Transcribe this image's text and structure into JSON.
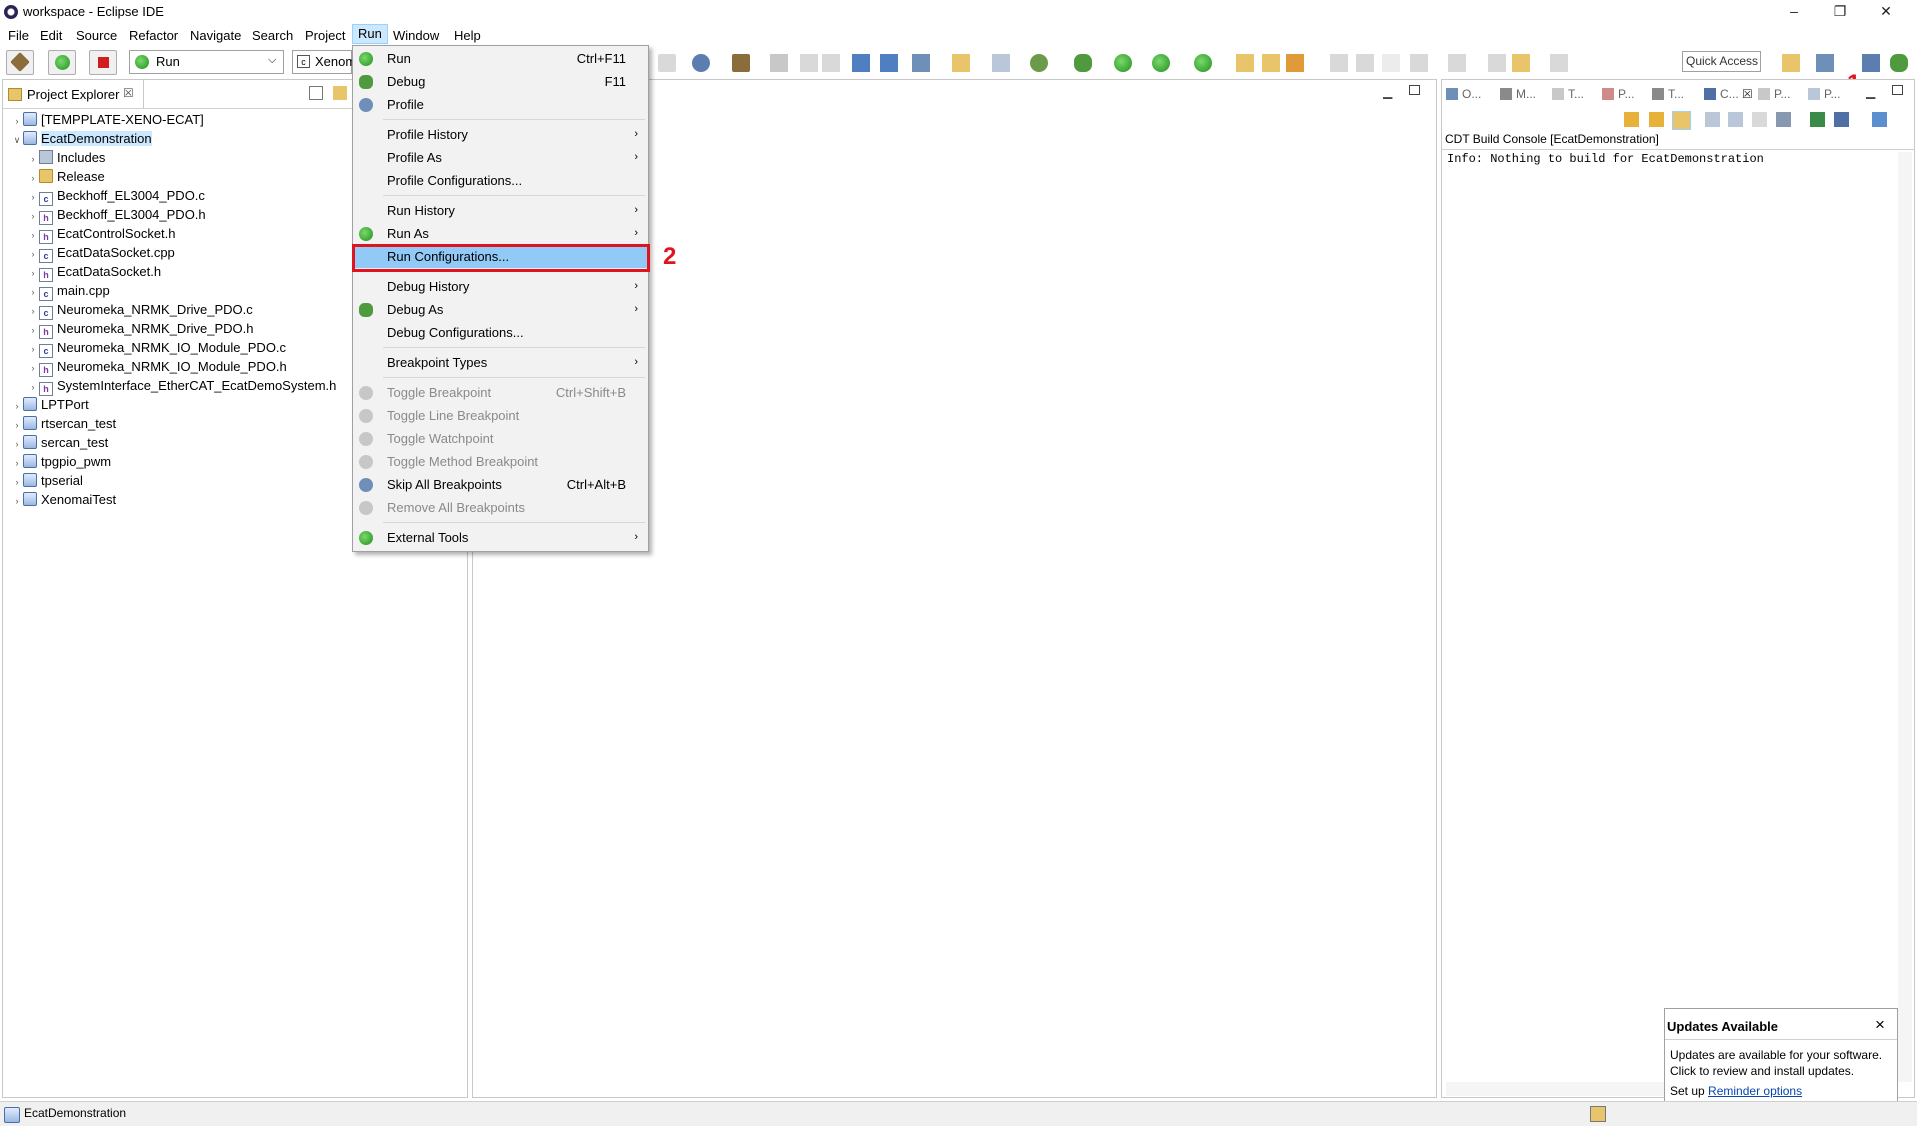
{
  "window": {
    "title": "workspace - Eclipse IDE",
    "minimize": "–",
    "restore": "❐",
    "close": "✕"
  },
  "menubar": [
    "File",
    "Edit",
    "Source",
    "Refactor",
    "Navigate",
    "Search",
    "Project",
    "Run",
    "Window",
    "Help"
  ],
  "toolbar": {
    "run_combo_value": "Run",
    "target_combo_value": "Xenom",
    "quick_access": "Quick Access"
  },
  "project_explorer": {
    "tab_label": "Project Explorer",
    "tab_close": "☒",
    "projects": [
      {
        "label": "[TEMPPLATE-XENO-ECAT]",
        "expanded": false
      },
      {
        "label": "EcatDemonstration",
        "expanded": true,
        "selected": true,
        "children": [
          {
            "label": "Includes",
            "kind": "includes"
          },
          {
            "label": "Release",
            "kind": "folder"
          },
          {
            "label": "Beckhoff_EL3004_PDO.c",
            "kind": "c"
          },
          {
            "label": "Beckhoff_EL3004_PDO.h",
            "kind": "h"
          },
          {
            "label": "EcatControlSocket.h",
            "kind": "h"
          },
          {
            "label": "EcatDataSocket.cpp",
            "kind": "c"
          },
          {
            "label": "EcatDataSocket.h",
            "kind": "h"
          },
          {
            "label": "main.cpp",
            "kind": "c"
          },
          {
            "label": "Neuromeka_NRMK_Drive_PDO.c",
            "kind": "c"
          },
          {
            "label": "Neuromeka_NRMK_Drive_PDO.h",
            "kind": "h"
          },
          {
            "label": "Neuromeka_NRMK_IO_Module_PDO.c",
            "kind": "c"
          },
          {
            "label": "Neuromeka_NRMK_IO_Module_PDO.h",
            "kind": "h"
          },
          {
            "label": "SystemInterface_EtherCAT_EcatDemoSystem.h",
            "kind": "h"
          }
        ]
      },
      {
        "label": "LPTPort",
        "expanded": false
      },
      {
        "label": "rtsercan_test",
        "expanded": false
      },
      {
        "label": "sercan_test",
        "expanded": false
      },
      {
        "label": "tpgpio_pwm",
        "expanded": false
      },
      {
        "label": "tpserial",
        "expanded": false
      },
      {
        "label": "XenomaiTest",
        "expanded": false
      }
    ]
  },
  "run_menu": {
    "items": [
      {
        "label": "Run",
        "shortcut": "Ctrl+F11",
        "icon": "run-icon"
      },
      {
        "label": "Debug",
        "shortcut": "F11",
        "icon": "debug-icon"
      },
      {
        "label": "Profile",
        "shortcut": "",
        "icon": "profile-icon"
      },
      {
        "sep": true
      },
      {
        "label": "Profile History",
        "submenu": true
      },
      {
        "label": "Profile As",
        "submenu": true
      },
      {
        "label": "Profile Configurations..."
      },
      {
        "sep": true
      },
      {
        "label": "Run History",
        "submenu": true
      },
      {
        "label": "Run As",
        "submenu": true,
        "icon": "run-as-icon"
      },
      {
        "label": "Run Configurations...",
        "highlighted": true
      },
      {
        "sep": true
      },
      {
        "label": "Debug History",
        "submenu": true
      },
      {
        "label": "Debug As",
        "submenu": true,
        "icon": "debug-as-icon"
      },
      {
        "label": "Debug Configurations..."
      },
      {
        "sep": true
      },
      {
        "label": "Breakpoint Types",
        "submenu": true
      },
      {
        "sep": true
      },
      {
        "label": "Toggle Breakpoint",
        "shortcut": "Ctrl+Shift+B",
        "disabled": true,
        "icon": "breakpoint-icon"
      },
      {
        "label": "Toggle Line Breakpoint",
        "disabled": true,
        "icon": "line-breakpoint-icon"
      },
      {
        "label": "Toggle Watchpoint",
        "disabled": true,
        "icon": "watchpoint-icon"
      },
      {
        "label": "Toggle Method Breakpoint",
        "disabled": true,
        "icon": "method-breakpoint-icon"
      },
      {
        "label": "Skip All Breakpoints",
        "shortcut": "Ctrl+Alt+B",
        "icon": "skip-breakpoints-icon"
      },
      {
        "label": "Remove All Breakpoints",
        "disabled": true,
        "icon": "remove-breakpoints-icon"
      },
      {
        "sep": true
      },
      {
        "label": "External Tools",
        "submenu": true,
        "icon": "external-tools-icon"
      }
    ]
  },
  "annotations": {
    "callout_1": "1",
    "callout_2": "2"
  },
  "right_panel": {
    "tabs": [
      "O...",
      "M...",
      "T...",
      "P...",
      "T...",
      "C...",
      "P...",
      "P..."
    ],
    "console_title": "CDT Build Console [EcatDemonstration]",
    "console_text": "Info: Nothing to build for EcatDemonstration"
  },
  "updates_popup": {
    "title": "Updates Available",
    "close": "×",
    "line1": "Updates are available for your software.",
    "line2": "Click to review and install updates.",
    "setup_prefix": "Set up",
    "link": "Reminder options"
  },
  "statusbar": {
    "text": "EcatDemonstration"
  },
  "colors": {
    "highlight": "#91c9f7",
    "callout": "#e0141e",
    "selection": "#cce8ff"
  }
}
